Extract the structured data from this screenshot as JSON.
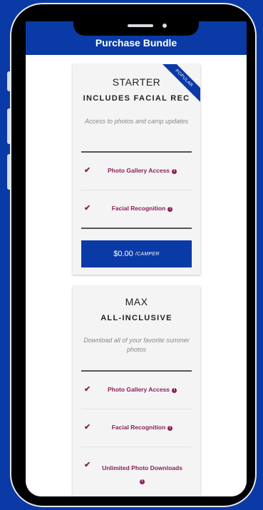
{
  "header": {
    "title": "Purchase Bundle"
  },
  "plans": [
    {
      "name": "STARTER",
      "subtitle": "INCLUDES FACIAL REC",
      "description": "Access to photos and camp updates",
      "badge": "POPULAR",
      "features": [
        {
          "label": "Photo Gallery Access",
          "info_icon": "info-icon"
        },
        {
          "label": "Facial Recognition",
          "info_icon": "info-icon"
        }
      ],
      "price": "$0.00",
      "price_unit": "/CAMPER"
    },
    {
      "name": "MAX",
      "subtitle": "ALL-INCLUSIVE",
      "description": "Download all of your favorite summer photos",
      "features": [
        {
          "label": "Photo Gallery Access",
          "info_icon": "info-icon"
        },
        {
          "label": "Facial Recognition",
          "info_icon": "info-icon"
        },
        {
          "label": "Unlimited Photo Downloads",
          "info_icon": "info-icon"
        }
      ]
    }
  ],
  "colors": {
    "brand_blue": "#0a3aa6",
    "feature_magenta": "#8a1f5e"
  }
}
